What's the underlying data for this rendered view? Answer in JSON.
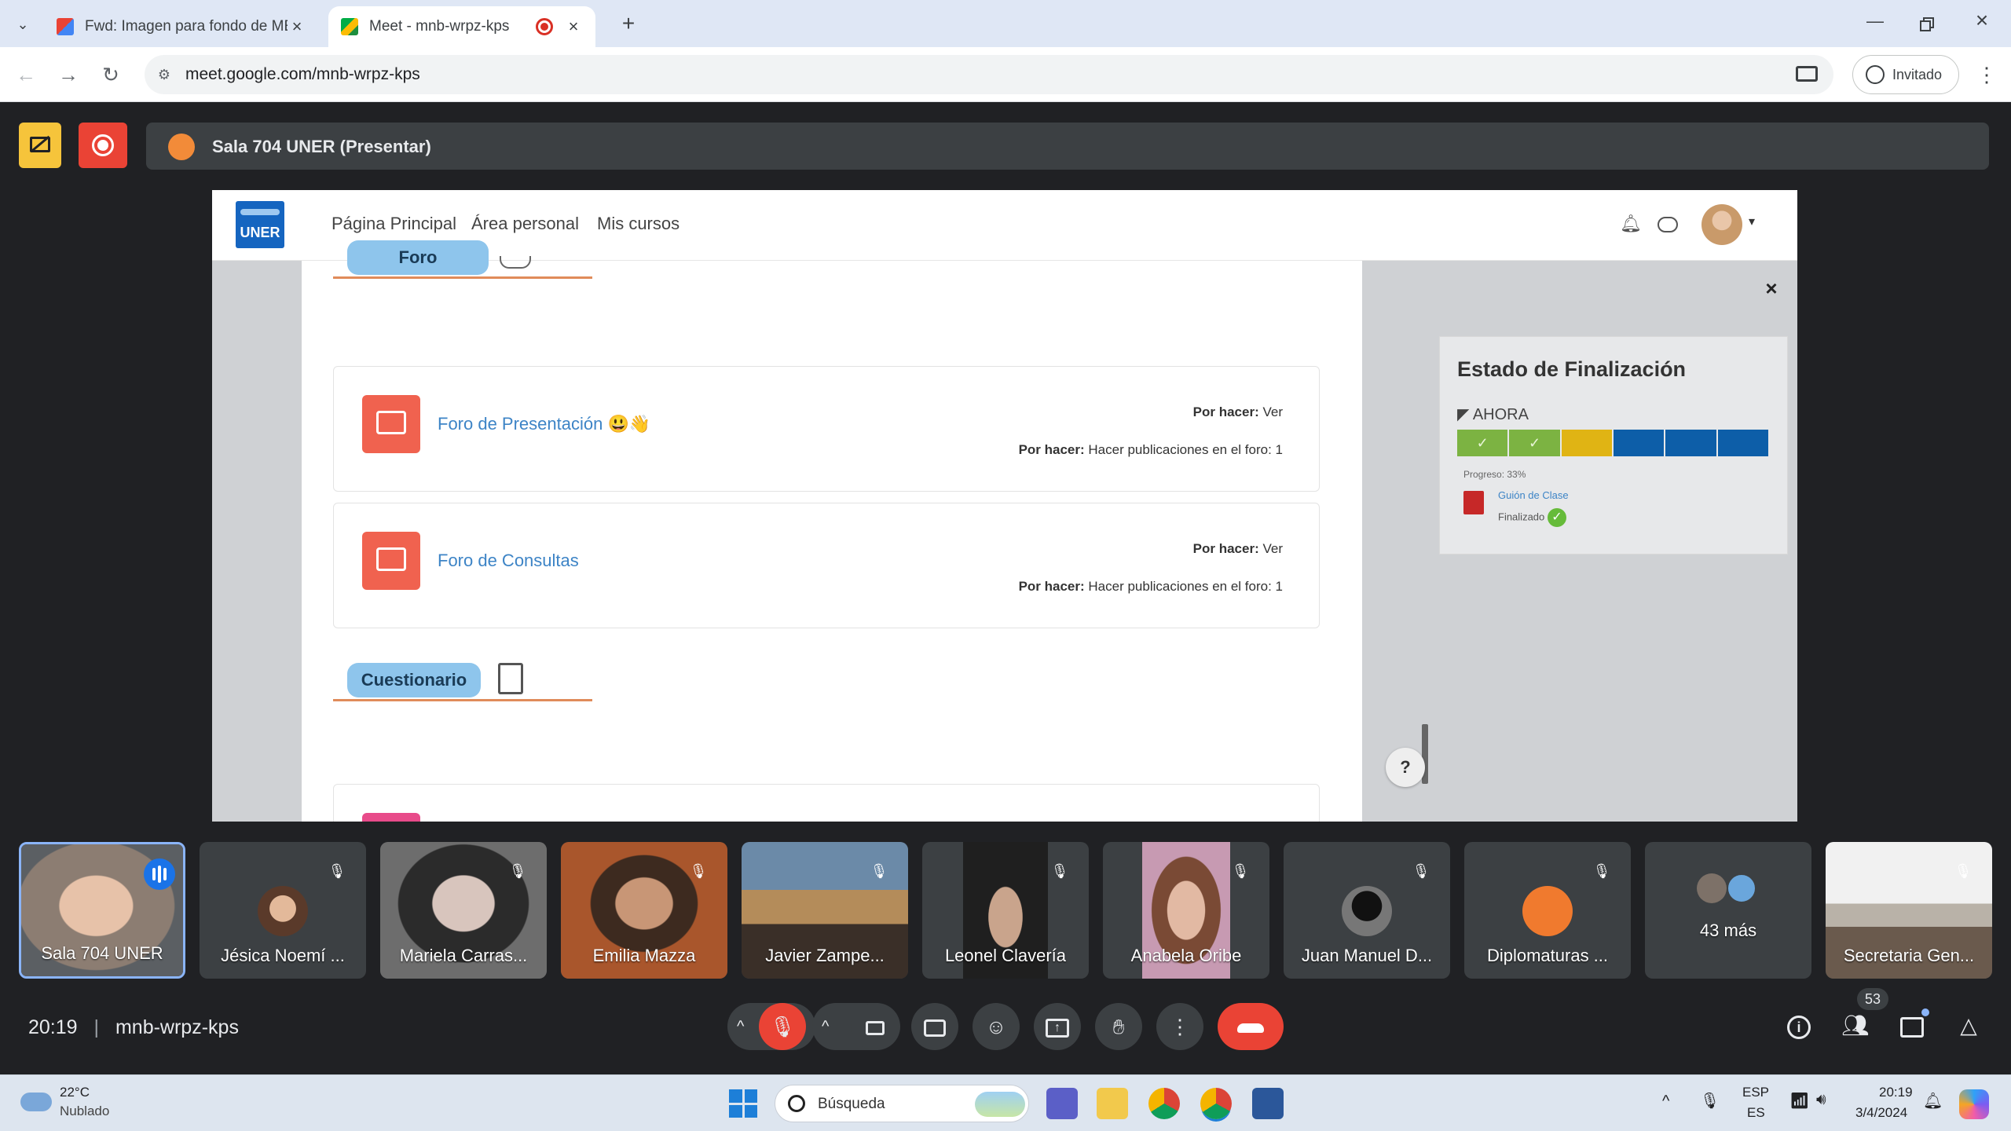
{
  "browser": {
    "tabs": [
      {
        "label": "Fwd: Imagen para fondo de ME",
        "active": false
      },
      {
        "label": "Meet - mnb-wrpz-kps",
        "active": true
      }
    ],
    "new_tab_label": "+",
    "url": "meet.google.com/mnb-wrpz-kps",
    "profile_label": "Invitado"
  },
  "meet": {
    "presenter_label": "Sala 704 UNER (Presentar)",
    "time": "20:19",
    "meeting_code": "mnb-wrpz-kps",
    "people_count": "53",
    "participants": [
      {
        "name": "Sala 704 UNER",
        "muted": false,
        "speaking": true
      },
      {
        "name": "Jésica Noemí ...",
        "muted": true
      },
      {
        "name": "Mariela Carras...",
        "muted": true
      },
      {
        "name": "Emilia Mazza",
        "muted": true
      },
      {
        "name": "Javier Zampe...",
        "muted": true
      },
      {
        "name": "Leonel Clavería",
        "muted": true
      },
      {
        "name": "Anabela Oribe",
        "muted": true
      },
      {
        "name": "Juan Manuel D...",
        "muted": true
      },
      {
        "name": "Diplomaturas ...",
        "muted": true
      },
      {
        "name": "43 más",
        "muted": false
      },
      {
        "name": "Secretaria Gen...",
        "muted": true
      }
    ]
  },
  "moodle": {
    "logo_text": "UNER",
    "nav": [
      "Página Principal",
      "Área personal",
      "Mis cursos"
    ],
    "section_foro": "Foro",
    "section_cuestionario": "Cuestionario",
    "activities": [
      {
        "name": "Foro de Presentación 😃👋",
        "todo1_label": "Por hacer:",
        "todo1_value": "Ver",
        "todo2_label": "Por hacer:",
        "todo2_value": "Hacer publicaciones en el foro: 1"
      },
      {
        "name": "Foro de Consultas",
        "todo1_label": "Por hacer:",
        "todo1_value": "Ver",
        "todo2_label": "Por hacer:",
        "todo2_value": "Hacer publicaciones en el foro: 1"
      }
    ],
    "completion": {
      "title": "Estado de Finalización",
      "now_label": "AHORA",
      "progress_text": "Progreso: 33%",
      "progress_fraction": 0.33,
      "segment_colors": [
        "#7cb342",
        "#7cb342",
        "#e0b414",
        "#0d5ea8",
        "#0d5ea8",
        "#0d5ea8"
      ],
      "item_name": "Guión de Clase",
      "item_status": "Finalizado"
    },
    "help_label": "?"
  },
  "taskbar": {
    "weather_temp": "22°C",
    "weather_desc": "Nublado",
    "search_label": "Búsqueda",
    "lang_top": "ESP",
    "lang_bottom": "ES",
    "clock_time": "20:19",
    "clock_date": "3/4/2024"
  },
  "colors": {
    "meet_bg": "#202124",
    "end_call": "#ea4335",
    "mic_off": "#ea4335",
    "accent_blue": "#8ab4f8"
  }
}
